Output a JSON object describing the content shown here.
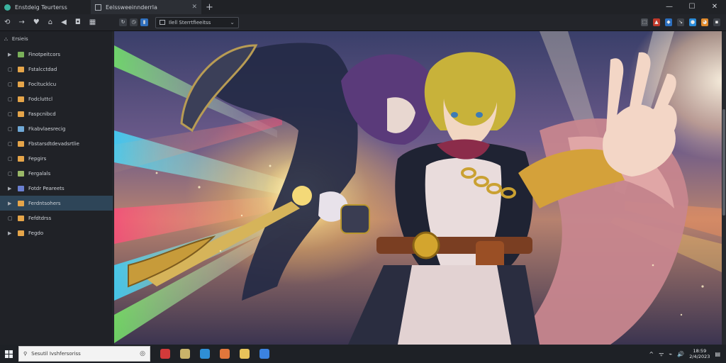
{
  "titlebar": {
    "tabs": [
      {
        "label": "Enstdeig Teurterss",
        "active": false
      },
      {
        "label": "Eelssweeinnderrla",
        "active": true
      }
    ],
    "close_glyph": "✕",
    "new_tab_glyph": "+",
    "window_controls": [
      "—",
      "☐",
      "✕"
    ]
  },
  "toolbar": {
    "nav": [
      "back-icon",
      "forward-icon",
      "shield-icon",
      "home-icon",
      "share-icon",
      "camera-icon",
      "grid-icon"
    ],
    "dropdown_value": "Ilell  Sterrtfieeitss",
    "right_icons": [
      "puzzle-icon",
      "cloud-icon",
      "download-icon",
      "extension-icon",
      "star-icon",
      "settings-icon",
      "profile-icon"
    ]
  },
  "sidebar": {
    "header": "Ersieis",
    "items": [
      {
        "label": "Finotpeitcors",
        "color": "#7ab05a",
        "expanded": false,
        "selected": false
      },
      {
        "label": "Fstalcctdad",
        "color": "#e5a54a",
        "expanded": true,
        "selected": false
      },
      {
        "label": "Focltucklcu",
        "color": "#e5a54a",
        "expanded": true,
        "selected": false
      },
      {
        "label": "Fodcluttcl",
        "color": "#e5a54a",
        "expanded": true,
        "selected": false
      },
      {
        "label": "Faspcnibcd",
        "color": "#e5a54a",
        "expanded": true,
        "selected": false
      },
      {
        "label": "Fkabvlaesrecig",
        "color": "#6fa8d6",
        "expanded": true,
        "selected": false
      },
      {
        "label": "Fbstarsdtdevadsrtlie",
        "color": "#e5a54a",
        "expanded": true,
        "selected": false
      },
      {
        "label": "Fepgirs",
        "color": "#e5a54a",
        "expanded": true,
        "selected": false
      },
      {
        "label": "Fergalals",
        "color": "#9ab868",
        "expanded": true,
        "selected": false
      },
      {
        "label": "Fotdr Peareets",
        "color": "#6a7fd0",
        "expanded": false,
        "selected": false
      },
      {
        "label": "Ferdntsohers",
        "color": "#e5a54a",
        "expanded": false,
        "selected": true
      },
      {
        "label": "Fefdtdrss",
        "color": "#e5a54a",
        "expanded": true,
        "selected": false
      },
      {
        "label": "Fegdo",
        "color": "#e5a54a",
        "expanded": false,
        "selected": false
      }
    ]
  },
  "taskbar": {
    "search_placeholder": "Sesutil Ivshfersoriss",
    "apps": [
      {
        "icon": "red-app-icon",
        "color": "#d23a3a"
      },
      {
        "icon": "image-app-icon",
        "color": "#c9b36a"
      },
      {
        "icon": "edge-icon",
        "color": "#2f8fd6"
      },
      {
        "icon": "firefox-icon",
        "color": "#e2773b"
      },
      {
        "icon": "folder-icon",
        "color": "#e8c35a"
      },
      {
        "icon": "globe-icon",
        "color": "#3b82e0"
      }
    ],
    "tray": [
      "^",
      "ᯤ",
      "⌁",
      "🔊"
    ],
    "clock_time": "18:59",
    "clock_date": "2/4/2023",
    "notification_glyph": "▤"
  }
}
